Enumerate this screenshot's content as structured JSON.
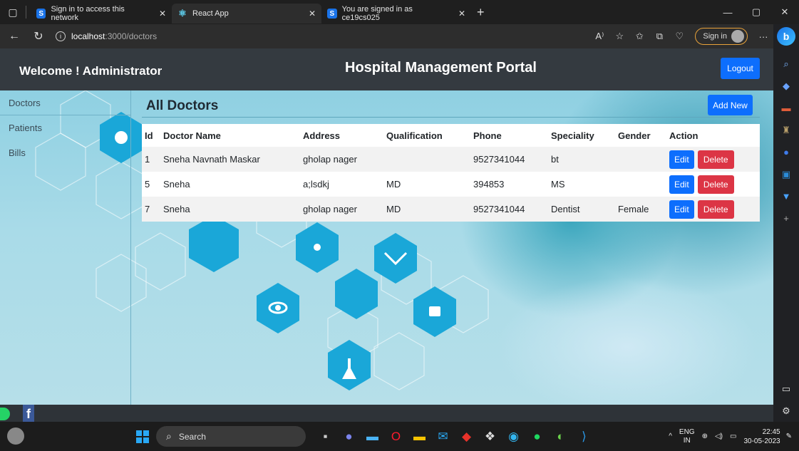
{
  "browser": {
    "tabs": [
      {
        "label": "Sign in to access this network",
        "favicon": "S"
      },
      {
        "label": "React App",
        "favicon": "react-icon"
      },
      {
        "label": "You are signed in as ce19cs025",
        "favicon": "S"
      }
    ],
    "url_host": "localhost",
    "url_path": ":3000/doctors",
    "sign_in_label": "Sign in"
  },
  "header": {
    "welcome": "Welcome ! Administrator",
    "title": "Hospital Management Portal",
    "logout_label": "Logout"
  },
  "sidebar": {
    "items": [
      {
        "label": "Doctors"
      },
      {
        "label": "Patients"
      },
      {
        "label": "Bills"
      }
    ]
  },
  "main": {
    "title": "All Doctors",
    "add_new_label": "Add New",
    "columns": [
      "Id",
      "Doctor Name",
      "Address",
      "Qualification",
      "Phone",
      "Speciality",
      "Gender",
      "Action"
    ],
    "rows": [
      {
        "id": "1",
        "name": "Sneha Navnath Maskar",
        "address": "gholap nager",
        "qualification": "",
        "phone": "9527341044",
        "speciality": "bt",
        "gender": ""
      },
      {
        "id": "5",
        "name": "Sneha",
        "address": "a;lsdkj",
        "qualification": "MD",
        "phone": "394853",
        "speciality": "MS",
        "gender": ""
      },
      {
        "id": "7",
        "name": "Sneha",
        "address": "gholap nager",
        "qualification": "MD",
        "phone": "9527341044",
        "speciality": "Dentist",
        "gender": "Female"
      }
    ],
    "edit_label": "Edit",
    "delete_label": "Delete"
  },
  "taskbar": {
    "search_label": "Search",
    "lang_top": "ENG",
    "lang_bottom": "IN",
    "time": "22:45",
    "date": "30-05-2023"
  },
  "colors": {
    "primary": "#0d6efd",
    "danger": "#dc3545",
    "header": "#343a40"
  }
}
